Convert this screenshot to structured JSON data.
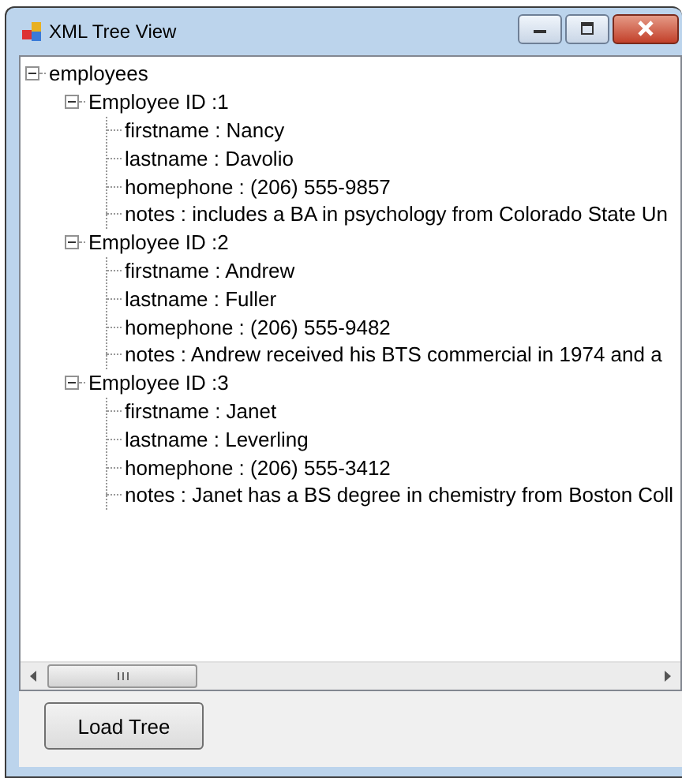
{
  "window": {
    "title": "XML Tree View"
  },
  "tree": [
    {
      "label": "employees",
      "expanded": true,
      "children": [
        {
          "label": "Employee ID :1",
          "expanded": true,
          "children": [
            {
              "label": "firstname : Nancy"
            },
            {
              "label": "lastname : Davolio"
            },
            {
              "label": "homephone : (206) 555-9857"
            },
            {
              "label": "notes : includes a BA in psychology from Colorado State Un"
            }
          ]
        },
        {
          "label": "Employee ID :2",
          "expanded": true,
          "children": [
            {
              "label": "firstname : Andrew"
            },
            {
              "label": "lastname : Fuller"
            },
            {
              "label": "homephone : (206) 555-9482"
            },
            {
              "label": "notes : Andrew received his BTS commercial in 1974 and a"
            }
          ]
        },
        {
          "label": "Employee ID :3",
          "expanded": true,
          "children": [
            {
              "label": "firstname : Janet"
            },
            {
              "label": "lastname : Leverling"
            },
            {
              "label": "homephone : (206) 555-3412"
            },
            {
              "label": "notes : Janet has a BS degree in chemistry from Boston Coll"
            }
          ]
        }
      ]
    }
  ],
  "buttons": [
    {
      "label": "Load Tree"
    }
  ]
}
